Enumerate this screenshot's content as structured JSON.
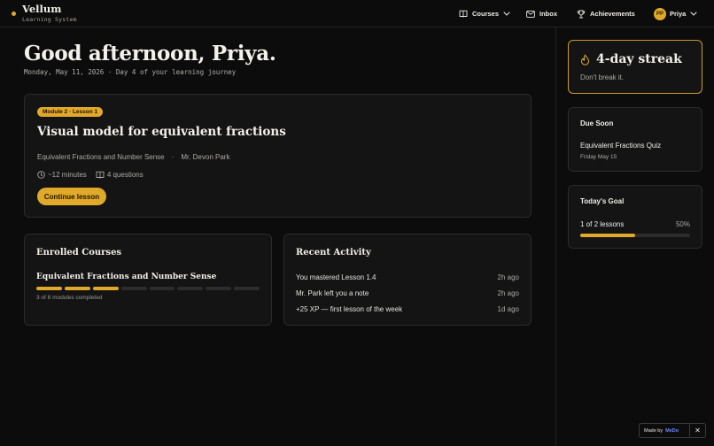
{
  "brand": {
    "name": "Vellum",
    "subtitle": "Learning System"
  },
  "nav": {
    "courses": "Courses",
    "inbox": "Inbox",
    "achievements": "Achievements",
    "user": {
      "initials": "PP",
      "name": "Priya"
    }
  },
  "greeting": {
    "title": "Good afternoon, Priya.",
    "date_line": "Monday, May 11, 2026 · Day 4 of your learning journey"
  },
  "lesson": {
    "badge": "Module 2 · Lesson 1",
    "title": "Visual model for equivalent fractions",
    "course": "Equivalent Fractions and Number Sense",
    "separator": "·",
    "instructor": "Mr. Devon Park",
    "duration": "~12 minutes",
    "questions": "4 questions",
    "cta": "Continue lesson"
  },
  "enrolled": {
    "heading": "Enrolled Courses",
    "course_name": "Equivalent Fractions and Number Sense",
    "modules_completed": 3,
    "modules_total": 8,
    "progress_text": "3 of 8 modules completed"
  },
  "activity": {
    "heading": "Recent Activity",
    "items": [
      {
        "text": "You mastered Lesson 1.4",
        "time": "2h ago"
      },
      {
        "text": "Mr. Park left you a note",
        "time": "2h ago"
      },
      {
        "text": "+25 XP — first lesson of the week",
        "time": "1d ago"
      }
    ]
  },
  "streak": {
    "title": "4-day streak",
    "subtitle": "Don't break it."
  },
  "due_soon": {
    "heading": "Due Soon",
    "item": "Equivalent Fractions Quiz",
    "date": "Friday May 15"
  },
  "goal": {
    "heading": "Today's Goal",
    "progress_text": "1 of 2 lessons",
    "percent_text": "50%",
    "fraction": 0.5
  },
  "made_by": {
    "label": "Made by",
    "logo": "MeDo",
    "close": "✕"
  },
  "colors": {
    "accent": "#e0a92a",
    "background": "#0c0c0c",
    "card": "#141414"
  }
}
